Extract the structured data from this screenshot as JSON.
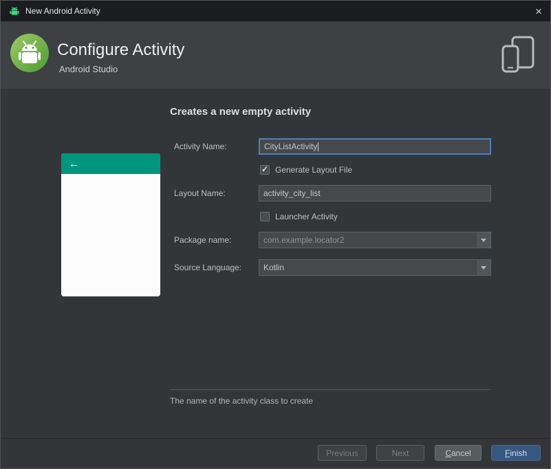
{
  "window": {
    "title": "New Android Activity"
  },
  "titlebar": {
    "close_glyph": "×"
  },
  "header": {
    "title": "Configure Activity",
    "subtitle": "Android Studio"
  },
  "main": {
    "heading": "Creates a new empty activity",
    "fields": {
      "activity_name": {
        "label": "Activity Name:",
        "value": "CityListActivity",
        "focused": true
      },
      "generate_layout_file": {
        "label": "Generate Layout File",
        "checked": true
      },
      "layout_name": {
        "label": "Layout Name:",
        "value": "activity_city_list"
      },
      "launcher_activity": {
        "label": "Launcher Activity",
        "checked": false
      },
      "package_name": {
        "label": "Package name:",
        "value": "com.example.locator2"
      },
      "source_language": {
        "label": "Source Language:",
        "value": "Kotlin"
      }
    },
    "help_text": "The name of the activity class to create"
  },
  "preview": {
    "back_arrow": "←"
  },
  "footer": {
    "previous_label": "Previous",
    "next_label": "Next",
    "cancel_label": "Cancel",
    "finish_label": "Finish"
  },
  "icons": {
    "titlebar_app": "android-icon",
    "logo": "android-studio-logo-icon",
    "devices": "phone-tablet-devices-icon",
    "close": "close-icon",
    "dropdown": "chevron-down-icon",
    "checkbox_check": "✓"
  },
  "colors": {
    "accent_blue": "#4d7fbe",
    "android_green": "#3ddc84",
    "preview_teal": "#00957f",
    "finish_button": "#365880",
    "header_bg": "#3d4144",
    "body_bg": "#333639",
    "titlebar_bg": "#1b1c1f"
  }
}
